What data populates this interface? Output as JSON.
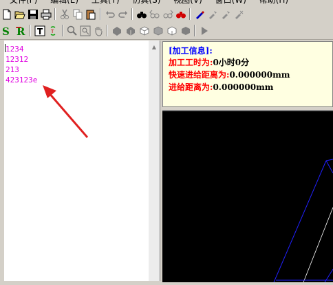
{
  "menu": [
    "文件(F)",
    "编辑(E)",
    "工具(T)",
    "仿真(S)",
    "视图(V)",
    "窗口(W)",
    "帮助(H)"
  ],
  "editor": {
    "lines": [
      "1234",
      "12312",
      "213",
      "423123e"
    ]
  },
  "info": {
    "title": "[加工信息]:",
    "time_label": "加工工时为:",
    "time_value": "0小时0分",
    "rapid_label": "快速进给距离为:",
    "rapid_value": "0.000000mm",
    "feed_label": "进给距离为:",
    "feed_value": "0.000000mm"
  },
  "icons_toolbar1": [
    "new-file-icon",
    "open-folder-icon",
    "save-icon",
    "print-icon",
    "cut-icon",
    "copy-icon",
    "paste-icon",
    "undo-icon",
    "redo-icon",
    "find-icon",
    "find-prev-icon",
    "find-next-icon",
    "replace-icon",
    "toggle-bookmark-icon",
    "next-bookmark-icon",
    "prev-bookmark-icon",
    "clear-bookmark-icon"
  ],
  "icons_toolbar2": [
    "s-icon",
    "r-icon",
    "tool-t-icon",
    "refresh-icon",
    "zoom-in-icon",
    "zoom-window-icon",
    "pan-hand-icon",
    "view-1-icon",
    "view-2-icon",
    "view-3-icon",
    "view-4-icon",
    "view-5-icon",
    "view-6-icon",
    "play-icon"
  ],
  "colors": {
    "code_text": "#e000e0",
    "info_title": "#0000ff",
    "info_key": "#ff0000",
    "info_bg": "#ffffe1",
    "view_bg": "#000000",
    "wireframe_blue": "#1a1aff",
    "annotation_arrow": "#e02020"
  }
}
